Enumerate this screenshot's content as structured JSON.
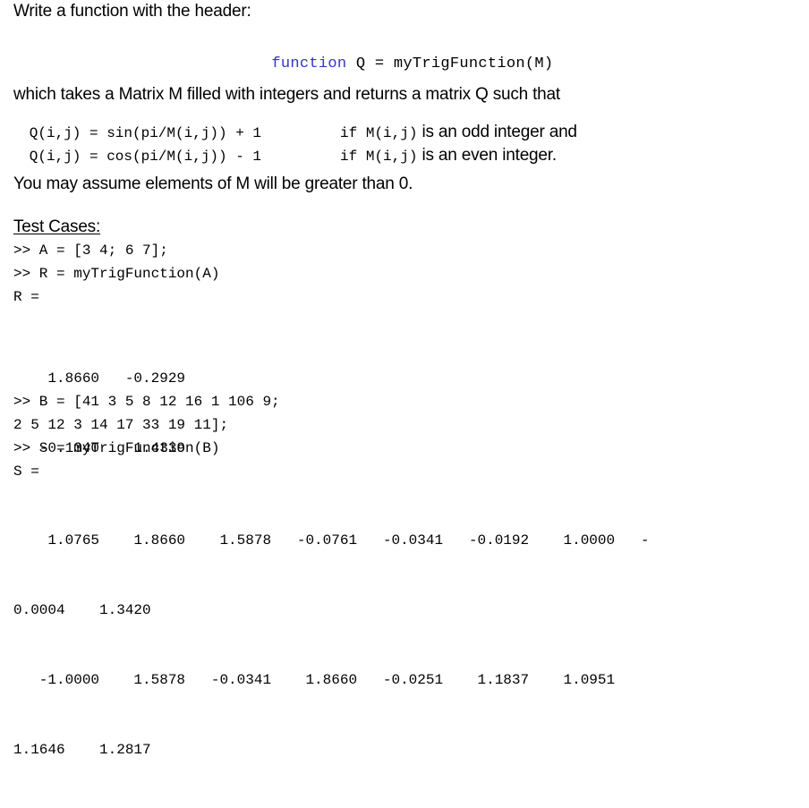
{
  "document": {
    "kind": "matlab-homework-problem-statement",
    "background_color": "#ffffff",
    "text_color": "#000000",
    "keyword_color": "#3333cc"
  },
  "intro": {
    "text": "Write a function with the header:"
  },
  "signature": {
    "keyword": "function",
    "rest": " Q = myTrigFunction(M)"
  },
  "description": {
    "line": "which takes a Matrix M filled with integers and returns a matrix Q such that"
  },
  "formulas": [
    {
      "expression": "Q(i,j) = sin(pi/M(i,j)) + 1",
      "condition_code": "if M(i,j)",
      "condition_text": " is an odd integer and"
    },
    {
      "expression": "Q(i,j) = cos(pi/M(i,j)) - 1",
      "condition_code": "if M(i,j)",
      "condition_text": " is an even integer."
    }
  ],
  "assumption": {
    "text": "You may assume elements of M will be greater than 0."
  },
  "test_cases": {
    "heading": "Test Cases:",
    "case_one": {
      "command_input": ">> A = [3 4; 6 7];",
      "command_call": ">> R = myTrigFunction(A)",
      "echo": "R =",
      "output_rows": [
        "    1.8660   -0.2929",
        "   -0.1340    1.4339"
      ]
    },
    "case_two": {
      "command_input_line1": ">> B = [41 3 5 8 12 16 1 106 9;",
      "command_input_line2": "2 5 12 3 14 17 33 19 11];",
      "command_call": ">> S = myTrigFunction(B)",
      "echo": "S =",
      "output_rows": [
        "    1.0765    1.8660    1.5878   -0.0761   -0.0341   -0.0192    1.0000   -",
        "0.0004    1.3420",
        "   -1.0000    1.5878   -0.0341    1.8660   -0.0251    1.1837    1.0951",
        "1.1646    1.2817"
      ]
    }
  },
  "matrix_values": {
    "R": [
      [
        1.866,
        -0.2929
      ],
      [
        -0.134,
        1.4339
      ]
    ],
    "B": [
      [
        41,
        3,
        5,
        8,
        12,
        16,
        1,
        106,
        9
      ],
      [
        2,
        5,
        12,
        3,
        14,
        17,
        33,
        19,
        11
      ]
    ],
    "A": [
      [
        3,
        4
      ],
      [
        6,
        7
      ]
    ],
    "S": [
      [
        1.0765,
        1.866,
        1.5878,
        -0.0761,
        -0.0341,
        -0.0192,
        1.0,
        -0.0004,
        1.342
      ],
      [
        -1.0,
        1.5878,
        -0.0341,
        1.866,
        -0.0251,
        1.1837,
        1.0951,
        1.1646,
        1.2817
      ]
    ]
  }
}
